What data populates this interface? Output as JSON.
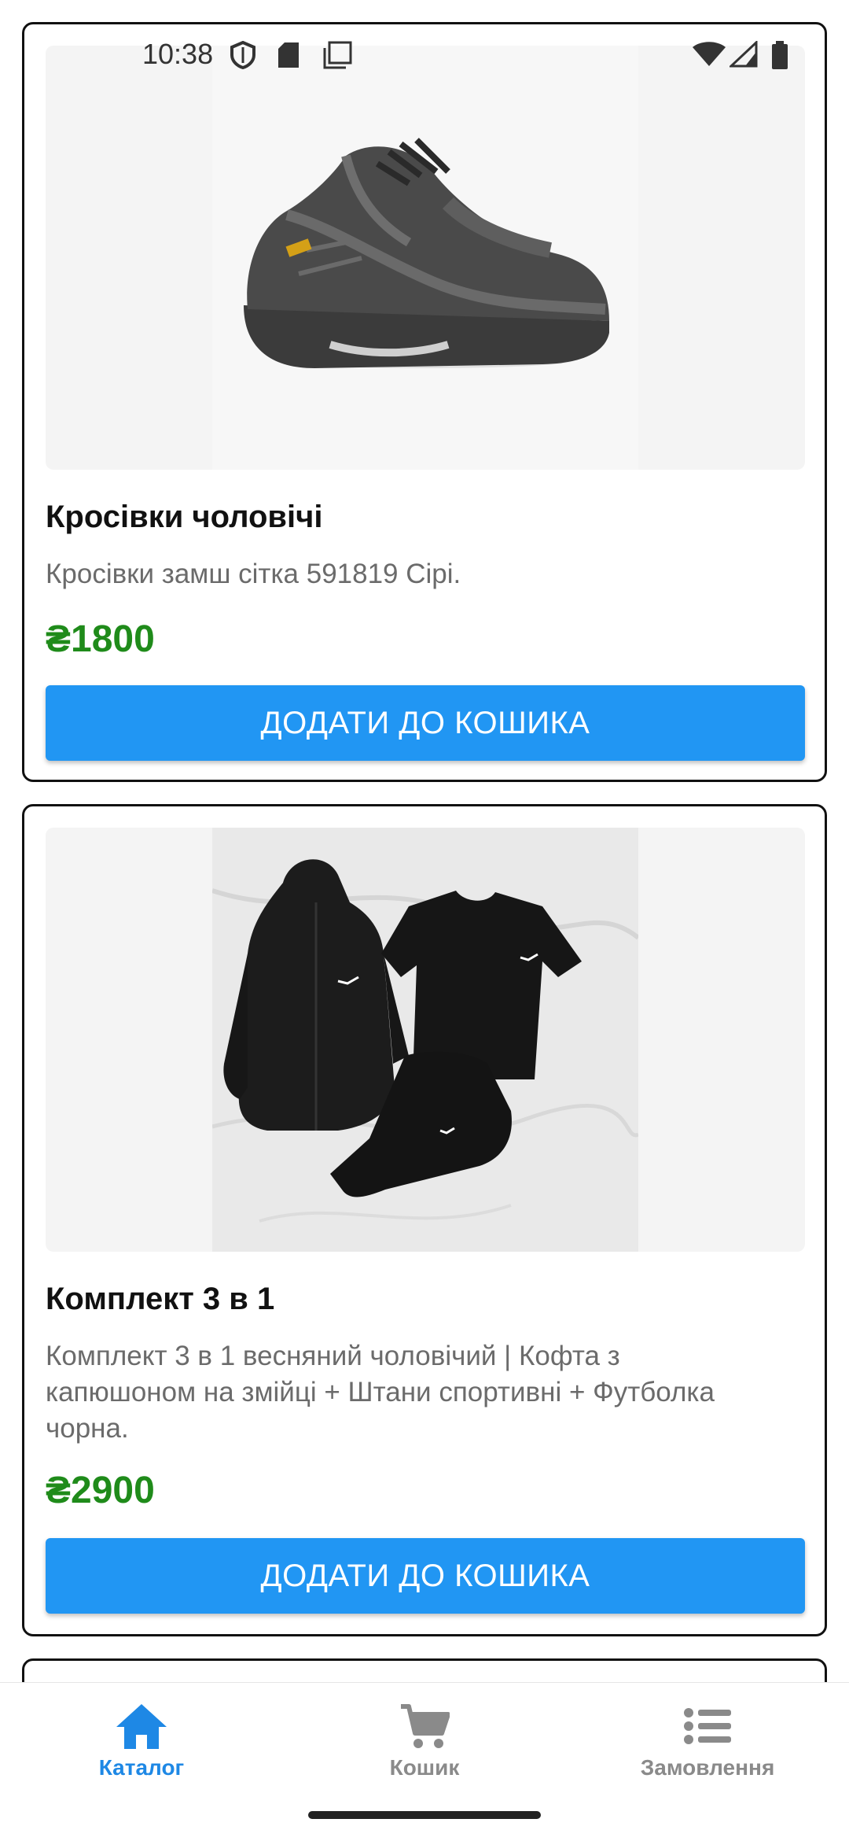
{
  "status_bar": {
    "time": "10:38",
    "left_icons": [
      "shield-icon",
      "sd-card-icon",
      "copy-icon"
    ],
    "right_icons": [
      "wifi-icon",
      "signal-icon",
      "battery-icon"
    ]
  },
  "products": [
    {
      "image": "grey-sneaker",
      "title": "Кросівки чоловічі",
      "description": "Кросівки замш сітка 591819 Сірі.",
      "price": "₴1800",
      "button_label": "ДОДАТИ ДО КОШИКА"
    },
    {
      "image": "black-tracksuit-set",
      "title": "Комплект 3 в 1",
      "description": "Комплект 3 в 1 весняний чоловічий | Кофта з капюшоном на змійці + Штани спортивні + Футболка чорна.",
      "price": "₴2900",
      "button_label": "ДОДАТИ ДО КОШИКА"
    }
  ],
  "bottom_nav": {
    "items": [
      {
        "label": "Каталог",
        "icon": "home-icon",
        "active": true
      },
      {
        "label": "Кошик",
        "icon": "cart-icon",
        "active": false
      },
      {
        "label": "Замовлення",
        "icon": "list-icon",
        "active": false
      }
    ]
  },
  "colors": {
    "accent": "#2196f3",
    "nav_active": "#1e88e5",
    "price": "#1f8b1a",
    "nav_inactive": "#8a8a8a"
  }
}
